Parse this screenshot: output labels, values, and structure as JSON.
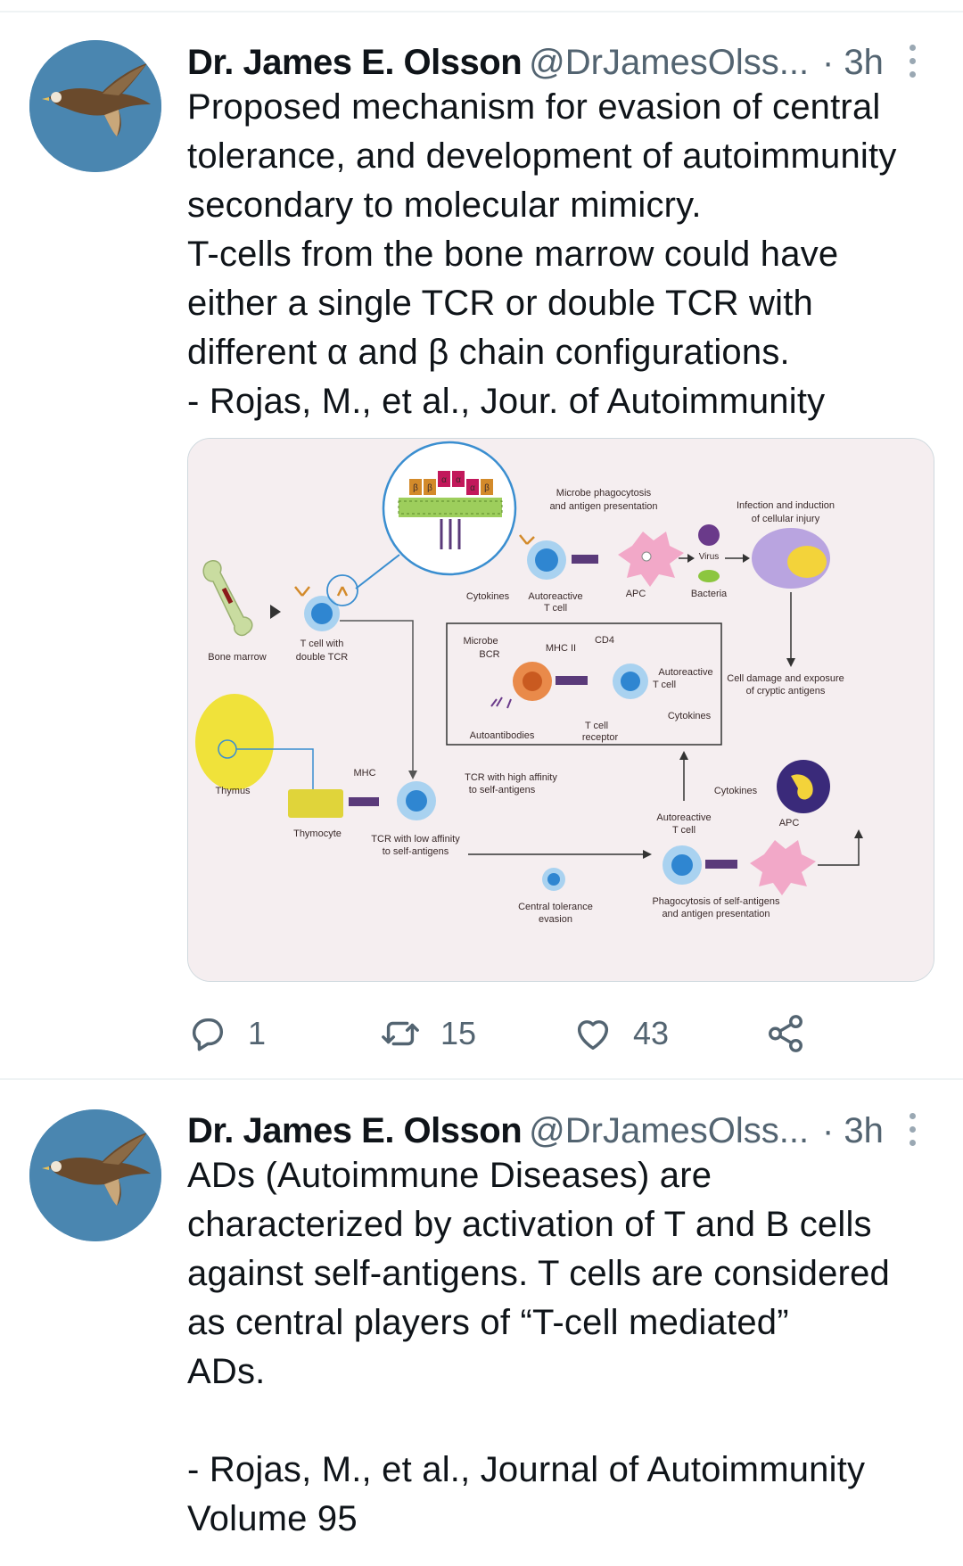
{
  "tweets": [
    {
      "name": "Dr. James E. Olsson",
      "handle": "@DrJamesOlss...",
      "time": "· 3h",
      "text": "Proposed mechanism for evasion of central\ntolerance, and development of autoimmunity\nsecondary to molecular mimicry.\nT-cells from the bone marrow could have\neither a single TCR or double TCR with\ndifferent α and β chain configurations.\n- Rojas, M., et al., Jour. of Autoimmunity",
      "replies": "1",
      "retweets": "15",
      "likes": "43",
      "figure": {
        "labels": {
          "microbe_phago": "Microbe phagocytosis",
          "antigen_pres": "and antigen presentation",
          "infection1": "Infection and induction",
          "infection2": "of cellular injury",
          "virus": "Virus",
          "bacteria": "Bacteria",
          "apc_top": "APC",
          "cytokines_top": "Cytokines",
          "autoreactive_top1": "Autoreactive",
          "autoreactive_top2": "T cell",
          "bone_marrow": "Bone marrow",
          "tcell_double1": "T cell with",
          "tcell_double2": "double TCR",
          "microbe": "Microbe",
          "bcr": "BCR",
          "mhc2": "MHC II",
          "cd4": "CD4",
          "autoreactive_box1": "Autoreactive",
          "autoreactive_box2": "T cell",
          "cytokines_box": "Cytokines",
          "tcell_receptor1": "T cell",
          "tcell_receptor2": "receptor",
          "autoantibodies": "Autoantibodies",
          "cell_damage1": "Cell damage and exposure",
          "cell_damage2": "of cryptic antigens",
          "thymus": "Thymus",
          "mhc": "MHC",
          "thymocyte": "Thymocyte",
          "tcr_high1": "TCR with high affinity",
          "tcr_high2": "to self-antigens",
          "tcr_low1": "TCR with low affinity",
          "tcr_low2": "to self-antigens",
          "cytokines_mid": "Cytokines",
          "autoreactive_bot1": "Autoreactive",
          "autoreactive_bot2": "T cell",
          "apc_bot": "APC",
          "central1": "Central tolerance",
          "central2": "evasion",
          "phago_self1": "Phagocytosis of self-antigens",
          "phago_self2": "and antigen presentation",
          "beta": "β",
          "alpha": "α"
        }
      }
    },
    {
      "name": "Dr. James E. Olsson",
      "handle": "@DrJamesOlss...",
      "time": "· 3h",
      "text": "ADs (Autoimmune Diseases) are\ncharacterized by activation of T and B cells\nagainst self-antigens. T cells are considered\nas central players of “T-cell mediated”\nADs.\n\n- Rojas, M., et al., Journal of Autoimmunity\nVolume 95"
    }
  ],
  "icons": {
    "reply": "reply-icon",
    "retweet": "retweet-icon",
    "like": "heart-icon",
    "share": "share-icon",
    "more": "more-icon"
  },
  "colors": {
    "text": "#0f1419",
    "secondary": "#536471",
    "divider": "#eff3f4",
    "media_bg": "#f5eef0"
  }
}
